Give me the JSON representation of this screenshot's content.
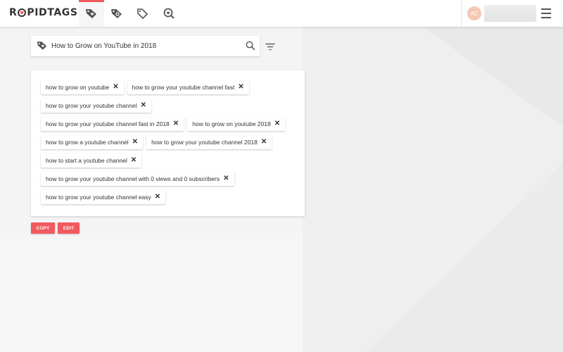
{
  "header": {
    "logo_text_pre": "R",
    "logo_text_post": "PIDTAGS",
    "nav": [
      {
        "name": "tag-generator",
        "icon": "tag-heart-icon",
        "active": true
      },
      {
        "name": "tag-analyzer",
        "icon": "tag-search-icon",
        "active": false
      },
      {
        "name": "tag-list",
        "icon": "tag-icon",
        "active": false
      },
      {
        "name": "explore",
        "icon": "search-heart-icon",
        "active": false
      }
    ],
    "avatar_initials": "AC"
  },
  "search": {
    "value": "How to Grow on YouTube in 2018",
    "placeholder": ""
  },
  "tags": [
    "how to grow on youtube",
    "how to grow your youtube channel fast",
    "how to grow your youtube channel",
    "how to grow your youtube channel fast in 2018",
    "how to grow on youtube 2018",
    "how to grow a youtube channel",
    "how to grow your youtube channel 2018",
    "how to start a youtube channel",
    "how to grow your youtube channel with 0 views and 0 subscribers",
    "how to grow your youtube channel easy"
  ],
  "remove_symbol": "✕",
  "actions": {
    "copy_label": "COPY",
    "edit_label": "EDIT"
  },
  "colors": {
    "accent": "#f05a5e",
    "avatar": "#f5c8b5"
  }
}
